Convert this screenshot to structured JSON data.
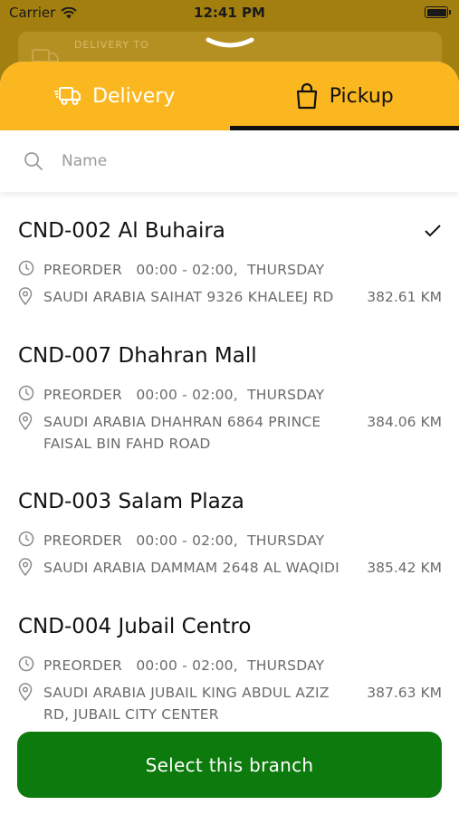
{
  "status_bar": {
    "carrier": "Carrier",
    "time": "12:41 PM"
  },
  "background": {
    "delivery_to_label": "DELIVERY TO"
  },
  "tabs": [
    {
      "label": "Delivery",
      "icon": "delivery-truck-icon",
      "active": false
    },
    {
      "label": "Pickup",
      "icon": "shopping-bag-icon",
      "active": true
    }
  ],
  "search": {
    "placeholder": "Name",
    "value": ""
  },
  "branches": [
    {
      "name": "CND-002 Al Buhaira",
      "selected": true,
      "schedule": "PREORDER   00:00 - 02:00,  THURSDAY",
      "address_lines": [
        "SAUDI ARABIA SAIHAT 9326 KHALEEJ RD"
      ],
      "distance": "382.61 KM"
    },
    {
      "name": "CND-007 Dhahran Mall",
      "selected": false,
      "schedule": "PREORDER   00:00 - 02:00,  THURSDAY",
      "address_lines": [
        "SAUDI ARABIA DHAHRAN 6864 PRINCE",
        "FAISAL BIN FAHD ROAD"
      ],
      "distance": "384.06 KM"
    },
    {
      "name": "CND-003 Salam Plaza",
      "selected": false,
      "schedule": "PREORDER   00:00 - 02:00,  THURSDAY",
      "address_lines": [
        "SAUDI ARABIA DAMMAM 2648 AL WAQIDI"
      ],
      "distance": "385.42 KM"
    },
    {
      "name": "CND-004 Jubail Centro",
      "selected": false,
      "schedule": "PREORDER   00:00 - 02:00,  THURSDAY",
      "address_lines": [
        "SAUDI ARABIA JUBAIL KING ABDUL AZIZ",
        "RD, JUBAIL CITY CENTER"
      ],
      "distance": "387.63 KM"
    }
  ],
  "select_button": {
    "label": "Select this branch"
  },
  "colors": {
    "accent": "#fbb71f",
    "button": "#0c7a0c",
    "muted_text": "#6b6b6b"
  }
}
